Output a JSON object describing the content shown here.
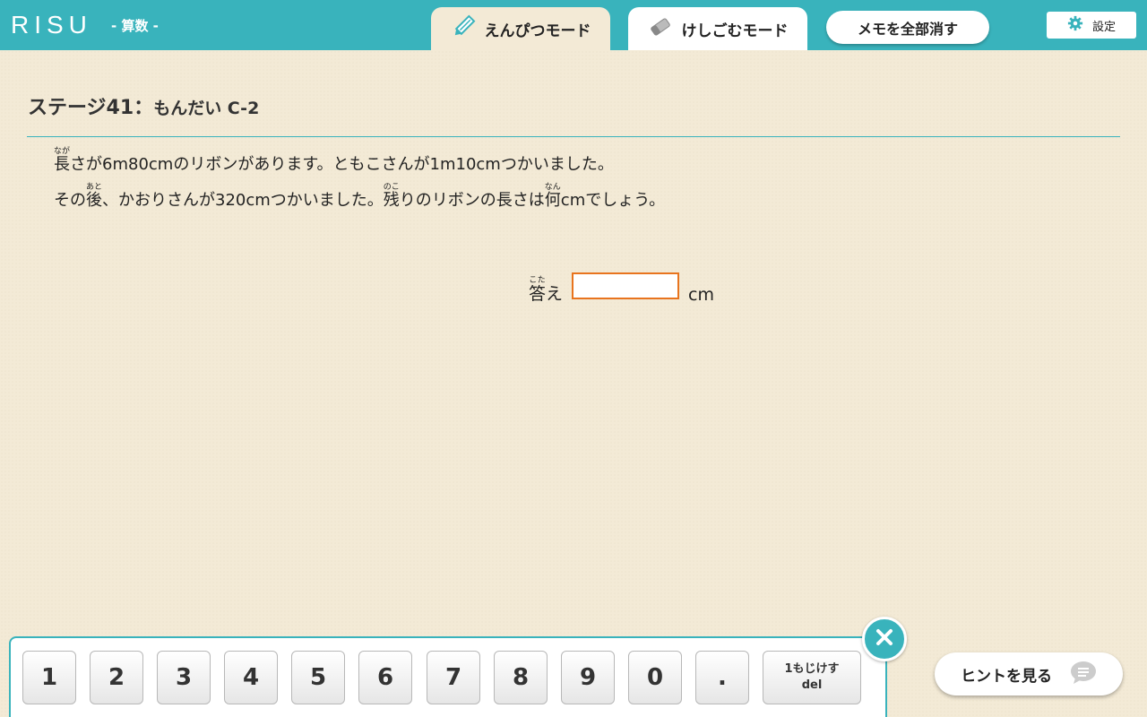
{
  "header": {
    "logo": "RISU",
    "subject": "- 算数 -",
    "pencil_mode": "えんぴつモード",
    "eraser_mode": "けしごむモード",
    "clear_memo": "メモを全部消す",
    "settings": "設定"
  },
  "stage": {
    "title": "ステージ41：",
    "subtitle": "もんだい C-2"
  },
  "question": {
    "line1_ruby1_base": "長",
    "line1_ruby1_rt": "なが",
    "line1_rest": "さが6m80cmのリボンがあります。ともこさんが1m10cmつかいました。",
    "line2_part1": "その",
    "line2_ruby1_base": "後",
    "line2_ruby1_rt": "あと",
    "line2_part2": "、かおりさんが320cmつかいました。",
    "line2_ruby2_base": "残",
    "line2_ruby2_rt": "のこ",
    "line2_part3": "りのリボンの長さは",
    "line2_ruby3_base": "何",
    "line2_ruby3_rt": "なん",
    "line2_part4": "cmでしょう。"
  },
  "answer": {
    "label_base": "答",
    "label_rt": "こた",
    "label_rest": "え",
    "value": "",
    "unit": "cm"
  },
  "keypad": {
    "keys": [
      "1",
      "2",
      "3",
      "4",
      "5",
      "6",
      "7",
      "8",
      "9",
      "0",
      "."
    ],
    "del_line1": "1もじけす",
    "del_line2": "del"
  },
  "hint": {
    "label": "ヒントを見る"
  },
  "colors": {
    "accent": "#39b3bc",
    "answer_border": "#e8741e",
    "background": "#f3ead6"
  }
}
